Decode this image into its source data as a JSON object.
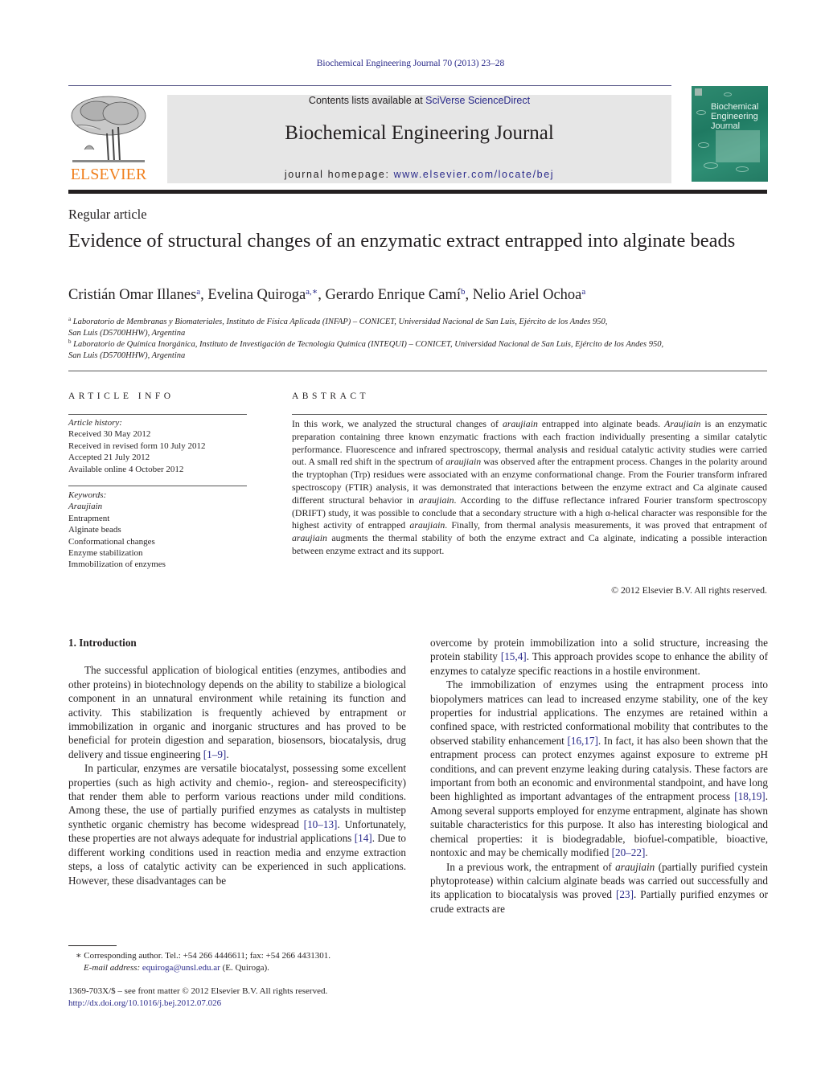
{
  "header": {
    "running_head": "Biochemical Engineering Journal 70 (2013) 23–28",
    "contents_prefix": "Contents lists available at ",
    "contents_link": "SciVerse ScienceDirect",
    "journal_name": "Biochemical Engineering Journal",
    "homepage_prefix": "journal homepage: ",
    "homepage_link": "www.elsevier.com/locate/bej",
    "publisher_word": "ELSEVIER",
    "cover_title_lines": [
      "Biochemical",
      "Engineering",
      "Journal"
    ],
    "colors": {
      "link": "#2a2a8a",
      "publisher_orange": "#f07f1d",
      "cover_green": "#2a8a6e",
      "masthead_gray": "#e6e6e6"
    }
  },
  "article": {
    "type": "Regular article",
    "title": "Evidence of structural changes of an enzymatic extract entrapped into alginate beads",
    "authors": [
      {
        "name": "Cristián Omar Illanes",
        "sup": "a",
        "sep": ", "
      },
      {
        "name": "Evelina Quiroga",
        "sup": "a,∗",
        "sep": ", "
      },
      {
        "name": "Gerardo Enrique Camí",
        "sup": "b",
        "sep": ", "
      },
      {
        "name": "Nelio Ariel Ochoa",
        "sup": "a",
        "sep": ""
      }
    ],
    "affiliations": [
      {
        "mark": "a",
        "line1": "Laboratorio de Membranas y Biomateriales, Instituto de Física Aplicada (INFAP) – CONICET, Universidad Nacional de San Luis, Ejército de los Andes 950,",
        "line2": "San Luis (D5700HHW), Argentina"
      },
      {
        "mark": "b",
        "line1": "Laboratorio de Química Inorgánica, Instituto de Investigación de Tecnología Química (INTEQUI) – CONICET, Universidad Nacional de San Luis, Ejército de los Andes 950,",
        "line2": "San Luis (D5700HHW), Argentina"
      }
    ]
  },
  "article_info": {
    "heading": "ARTICLE INFO",
    "history_label": "Article history:",
    "history": [
      "Received 30 May 2012",
      "Received in revised form 10 July 2012",
      "Accepted 21 July 2012",
      "Available online 4 October 2012"
    ],
    "keywords_label": "Keywords:",
    "keywords": [
      "Araujiain",
      "Entrapment",
      "Alginate beads",
      "Conformational changes",
      "Enzyme stabilization",
      "Immobilization of enzymes"
    ]
  },
  "abstract": {
    "heading": "ABSTRACT",
    "segments": [
      {
        "t": "In this work, we analyzed the structural changes of "
      },
      {
        "t": "araujiain",
        "i": true
      },
      {
        "t": " entrapped into alginate beads. "
      },
      {
        "t": "Araujiain",
        "i": true
      },
      {
        "t": " is an enzymatic preparation containing three known enzymatic fractions with each fraction individually presenting a similar catalytic performance. Fluorescence and infrared spectroscopy, thermal analysis and residual catalytic activity studies were carried out. A small red shift in the spectrum of "
      },
      {
        "t": "araujiain",
        "i": true
      },
      {
        "t": " was observed after the entrapment process. Changes in the polarity around the tryptophan (Trp) residues were associated with an enzyme conformational change. From the Fourier transform infrared spectroscopy (FTIR) analysis, it was demonstrated that interactions between the enzyme extract and Ca alginate caused different structural behavior in "
      },
      {
        "t": "araujiain",
        "i": true
      },
      {
        "t": ". According to the diffuse reflectance infrared Fourier transform spectroscopy (DRIFT) study, it was possible to conclude that a secondary structure with a high α-helical character was responsible for the highest activity of entrapped "
      },
      {
        "t": "araujiain",
        "i": true
      },
      {
        "t": ". Finally, from thermal analysis measurements, it was proved that entrapment of "
      },
      {
        "t": "araujiain",
        "i": true
      },
      {
        "t": " augments the thermal stability of both the enzyme extract and Ca alginate, indicating a possible interaction between enzyme extract and its support."
      }
    ],
    "copyright": "© 2012 Elsevier B.V. All rights reserved."
  },
  "body": {
    "section_heading": "1.  Introduction",
    "left_paragraphs": [
      {
        "indent": true,
        "segments": [
          {
            "t": "The successful application of biological entities (enzymes, antibodies and other proteins) in biotechnology depends on the ability to stabilize a biological component in an unnatural environment while retaining its function and activity. This stabilization is frequently achieved by entrapment or immobilization in organic and inorganic structures and has proved to be beneficial for protein digestion and separation, biosensors, biocatalysis, drug delivery and tissue engineering "
          },
          {
            "t": "[1–9]",
            "ref": true
          },
          {
            "t": "."
          }
        ]
      },
      {
        "indent": true,
        "segments": [
          {
            "t": "In particular, enzymes are versatile biocatalyst, possessing some excellent properties (such as high activity and chemio-, region- and stereospecificity) that render them able to perform various reactions under mild conditions. Among these, the use of partially purified enzymes as catalysts in multistep synthetic organic chemistry has become widespread "
          },
          {
            "t": "[10–13]",
            "ref": true
          },
          {
            "t": ". Unfortunately, these properties are not always adequate for industrial applications "
          },
          {
            "t": "[14]",
            "ref": true
          },
          {
            "t": ". Due to different working conditions used in reaction media and enzyme extraction steps, a loss of catalytic activity can be experienced in such applications. However, these disadvantages can be"
          }
        ]
      }
    ],
    "right_paragraphs": [
      {
        "indent": false,
        "segments": [
          {
            "t": "overcome by protein immobilization into a solid structure, increasing the protein stability "
          },
          {
            "t": "[15,4]",
            "ref": true
          },
          {
            "t": ". This approach provides scope to enhance the ability of enzymes to catalyze specific reactions in a hostile environment."
          }
        ]
      },
      {
        "indent": true,
        "segments": [
          {
            "t": "The immobilization of enzymes using the entrapment process into biopolymers matrices can lead to increased enzyme stability, one of the key properties for industrial applications. The enzymes are retained within a confined space, with restricted conformational mobility that contributes to the observed stability enhancement "
          },
          {
            "t": "[16,17]",
            "ref": true
          },
          {
            "t": ". In fact, it has also been shown that the entrapment process can protect enzymes against exposure to extreme pH conditions, and can prevent enzyme leaking during catalysis. These factors are important from both an economic and environmental standpoint, and have long been highlighted as important advantages of the entrapment process "
          },
          {
            "t": "[18,19]",
            "ref": true
          },
          {
            "t": ". Among several supports employed for enzyme entrapment, alginate has shown suitable characteristics for this purpose. It also has interesting biological and chemical properties: it is biodegradable, biofuel-compatible, bioactive, nontoxic and may be chemically modified "
          },
          {
            "t": "[20–22]",
            "ref": true
          },
          {
            "t": "."
          }
        ]
      },
      {
        "indent": true,
        "segments": [
          {
            "t": "In a previous work, the entrapment of "
          },
          {
            "t": "araujiain",
            "i": true
          },
          {
            "t": " (partially purified cystein phytoprotease) within calcium alginate beads was carried out successfully and its application to biocatalysis was proved "
          },
          {
            "t": "[23]",
            "ref": true
          },
          {
            "t": ". Partially purified enzymes or crude extracts are"
          }
        ]
      }
    ]
  },
  "footnote": {
    "mark": "∗",
    "text": "Corresponding author. Tel.: +54 266 4446611; fax: +54 266 4431301.",
    "email_label": "E-mail address:",
    "email": "equiroga@unsl.edu.ar",
    "email_suffix": " (E. Quiroga)."
  },
  "front_matter": {
    "issn_line": "1369-703X/$ – see front matter © 2012 Elsevier B.V. All rights reserved.",
    "doi": "http://dx.doi.org/10.1016/j.bej.2012.07.026"
  }
}
